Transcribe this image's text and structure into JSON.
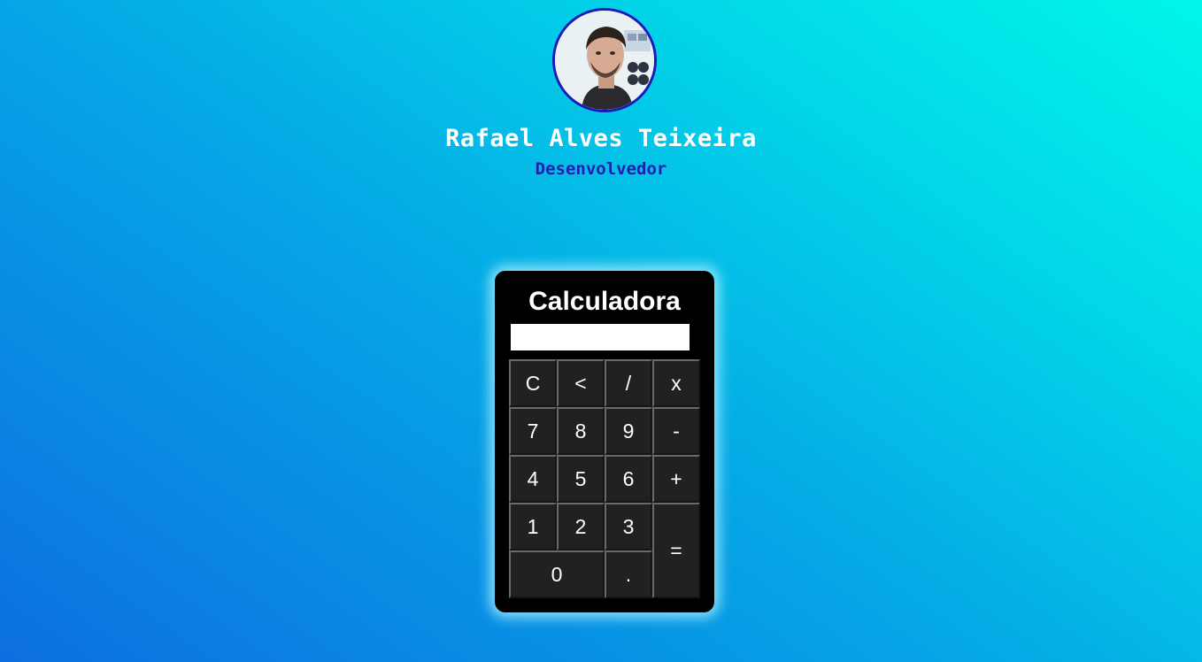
{
  "profile": {
    "name": "Rafael Alves Teixeira",
    "role": "Desenvolvedor"
  },
  "calculator": {
    "title": "Calculadora",
    "display_value": "",
    "keys": {
      "clear": "C",
      "backspace": "<",
      "divide": "/",
      "multiply": "x",
      "seven": "7",
      "eight": "8",
      "nine": "9",
      "minus": "-",
      "four": "4",
      "five": "5",
      "six": "6",
      "plus": "+",
      "one": "1",
      "two": "2",
      "three": "3",
      "equals": "=",
      "zero": "0",
      "decimal": "."
    }
  },
  "colors": {
    "background_start": "#0d6fe0",
    "background_end": "#00f6ea",
    "name_text": "#ffffff",
    "role_text": "#1f1fae",
    "avatar_border": "#1a1ab8",
    "calculator_body": "#000000",
    "key_background": "#212121"
  }
}
